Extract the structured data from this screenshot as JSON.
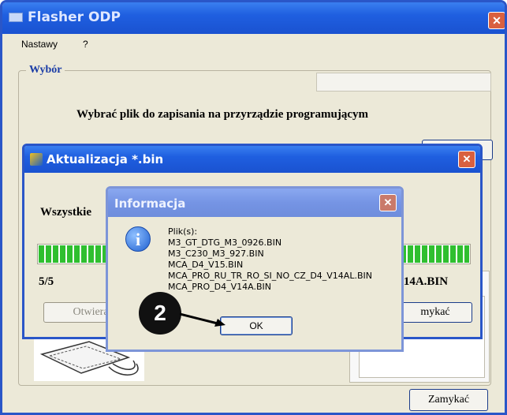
{
  "main_window": {
    "title": "Flasher ODP",
    "menu": [
      "Nastawy",
      "?"
    ],
    "group_label": "Wybór",
    "instruction": "Wybrać plik do zapisania na przyrządzie programującym",
    "close_label": "Zamykać"
  },
  "update_dialog": {
    "title": "Aktualizacja *.bin",
    "label": "Wszystkie",
    "progress_fraction": 1.0,
    "count": "5/5",
    "current_file": "V14A.BIN",
    "open_label": "Otwiera",
    "close_label": "mykać"
  },
  "info_dialog": {
    "title": "Informacja",
    "message_lines": [
      "Plik(s):",
      "M3_GT_DTG_M3_0926.BIN",
      "M3_C230_M3_927.BIN",
      "MCA_D4_V15.BIN",
      "MCA_PRO_RU_TR_RO_SI_NO_CZ_D4_V14AL.BIN",
      "MCA_PRO_D4_V14A.BIN"
    ],
    "ok_label": "OK"
  },
  "annotation": {
    "marker": "2"
  },
  "colors": {
    "title_bar": "#1f5fe0",
    "inactive_title_bar": "#7594e4",
    "progress": "#2fbf2f",
    "close_button": "#d9603f"
  }
}
